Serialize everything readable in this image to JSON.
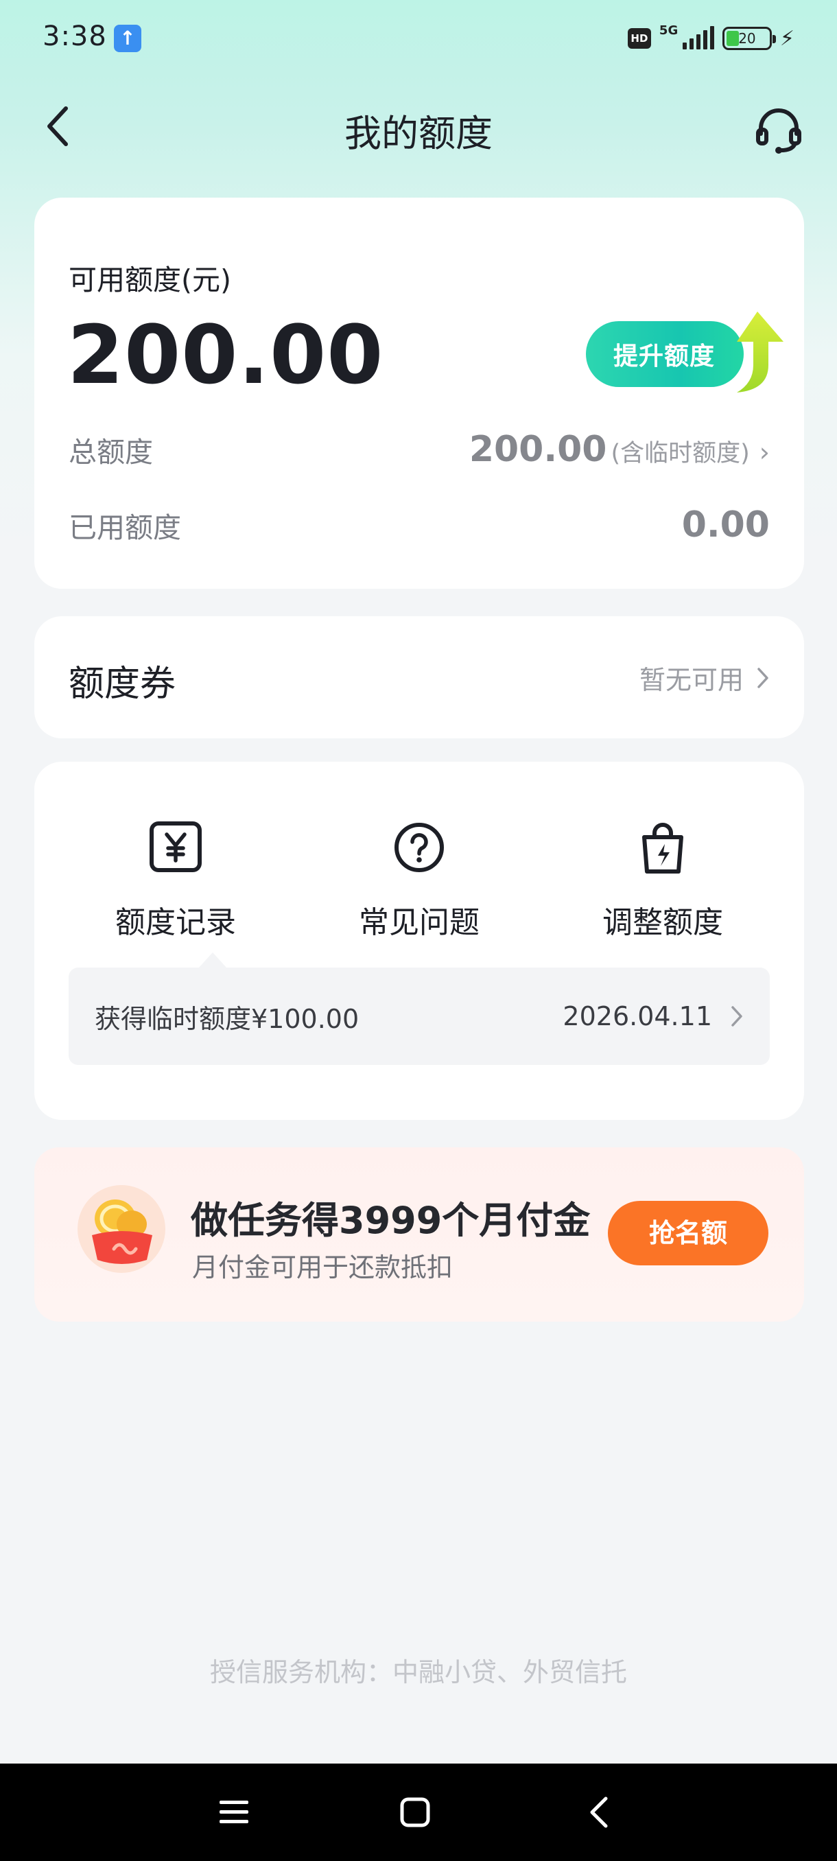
{
  "status_bar": {
    "time": "3:38",
    "network": "5G",
    "hd": "HD",
    "battery": "20"
  },
  "header": {
    "title": "我的额度"
  },
  "quota": {
    "available_label": "可用额度(元)",
    "available_amount": "200.00",
    "boost_label": "提升额度",
    "total_label": "总额度",
    "total_value": "200.00",
    "total_note": "(含临时额度)",
    "used_label": "已用额度",
    "used_value": "0.00"
  },
  "coupon": {
    "title": "额度券",
    "status": "暂无可用"
  },
  "tools": {
    "items": [
      {
        "label": "额度记录",
        "icon": "yen-record-icon"
      },
      {
        "label": "常见问题",
        "icon": "question-icon"
      },
      {
        "label": "调整额度",
        "icon": "bag-lightning-icon"
      }
    ],
    "record": {
      "text": "获得临时额度¥100.00",
      "date": "2026.04.11"
    }
  },
  "promo": {
    "title": "做任务得3999个月付金",
    "subtitle": "月付金可用于还款抵扣",
    "button": "抢名额"
  },
  "footer": {
    "note": "授信服务机构：中融小贷、外贸信托"
  },
  "colors": {
    "accent_green": "#17c6b0",
    "promo_orange": "#fb7426",
    "header_bg": "#bdf3e6"
  }
}
